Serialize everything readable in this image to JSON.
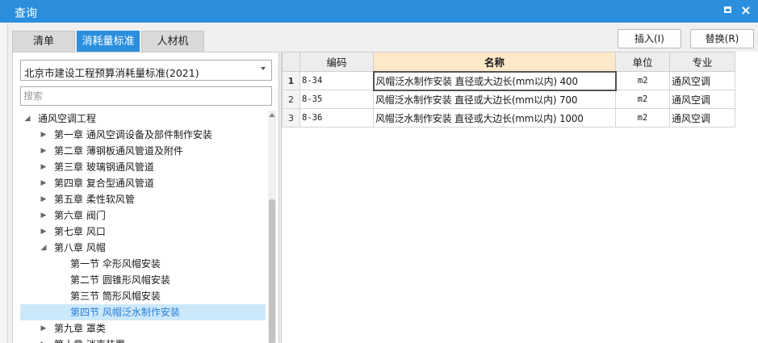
{
  "window": {
    "title": "查询",
    "maximize_glyph": "maximize-icon",
    "close_glyph": "×"
  },
  "tabs": [
    {
      "label": "清单",
      "active": false
    },
    {
      "label": "消耗量标准",
      "active": true
    },
    {
      "label": "人材机",
      "active": false
    }
  ],
  "actions": {
    "insert_label": "插入(I)",
    "replace_label": "替换(R)"
  },
  "left": {
    "standard_select": "北京市建设工程预算消耗量标准(2021)",
    "search_placeholder": "搜索",
    "tree": [
      {
        "label": "通风空调工程",
        "level": 0,
        "expanded": true
      },
      {
        "label": "第一章 通风空调设备及部件制作安装",
        "level": 1,
        "expanded": false
      },
      {
        "label": "第二章 薄钢板通风管道及附件",
        "level": 1,
        "expanded": false
      },
      {
        "label": "第三章 玻璃钢通风管道",
        "level": 1,
        "expanded": false
      },
      {
        "label": "第四章 复合型通风管道",
        "level": 1,
        "expanded": false
      },
      {
        "label": "第五章 柔性软风管",
        "level": 1,
        "expanded": false
      },
      {
        "label": "第六章 阀门",
        "level": 1,
        "expanded": false
      },
      {
        "label": "第七章 风口",
        "level": 1,
        "expanded": false
      },
      {
        "label": "第八章 风帽",
        "level": 1,
        "expanded": true
      },
      {
        "label": "第一节 伞形风帽安装",
        "level": 2
      },
      {
        "label": "第二节 圆锥形风帽安装",
        "level": 2
      },
      {
        "label": "第三节 筒形风帽安装",
        "level": 2
      },
      {
        "label": "第四节 风帽泛水制作安装",
        "level": 2,
        "selected": true
      },
      {
        "label": "第九章 罩类",
        "level": 1,
        "expanded": false
      },
      {
        "label": "第十章 消声装置",
        "level": 1,
        "expanded": false
      }
    ]
  },
  "grid": {
    "columns": [
      "编码",
      "名称",
      "单位",
      "专业"
    ],
    "rows": [
      {
        "no": "1",
        "code": "8-34",
        "name": "风帽泛水制作安装 直径或大边长(mm以内) 400",
        "unit": "m2",
        "major": "通风空调"
      },
      {
        "no": "2",
        "code": "8-35",
        "name": "风帽泛水制作安装 直径或大边长(mm以内) 700",
        "unit": "m2",
        "major": "通风空调"
      },
      {
        "no": "3",
        "code": "8-36",
        "name": "风帽泛水制作安装 直径或大边长(mm以内) 1000",
        "unit": "m2",
        "major": "通风空调"
      }
    ]
  },
  "colors": {
    "accent": "#2b8fde",
    "selected_row": "#cce8fb",
    "header_highlight": "#fde8c8"
  }
}
